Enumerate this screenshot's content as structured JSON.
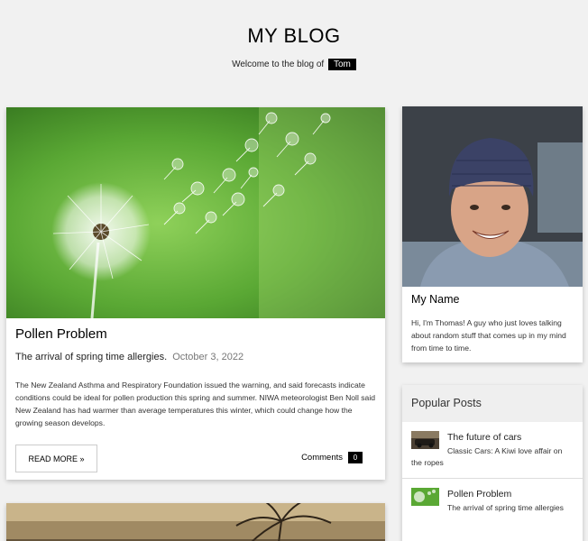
{
  "header": {
    "title": "MY BLOG",
    "welcome_text": "Welcome to the blog of",
    "author_tag": "Tom"
  },
  "post": {
    "title": "Pollen Problem",
    "subtitle": "The arrival of spring time allergies.",
    "date": "October 3, 2022",
    "body": "The New Zealand Asthma and Respiratory Foundation issued the warning, and said forecasts indicate conditions could be ideal for pollen production this spring and summer. NIWA meteorologist Ben Noll said New Zealand has had warmer than average temperatures this winter, which could change how the growing season develops.",
    "read_more_label": "READ MORE »",
    "comments_label": "Comments",
    "comments_count": "0"
  },
  "profile": {
    "name": "My Name",
    "bio": "Hi, I'm Thomas! A guy who just loves talking about random stuff that comes up in my mind from time to time."
  },
  "popular": {
    "header": "Popular Posts",
    "items": [
      {
        "title": "The future of cars",
        "description": "Classic Cars: A Kiwi love affair on the ropes"
      },
      {
        "title": "Pollen Problem",
        "description": "The arrival of spring time allergies"
      }
    ]
  },
  "colors": {
    "background": "#f1f1f1",
    "tag_bg": "#000000",
    "card_bg": "#ffffff"
  }
}
